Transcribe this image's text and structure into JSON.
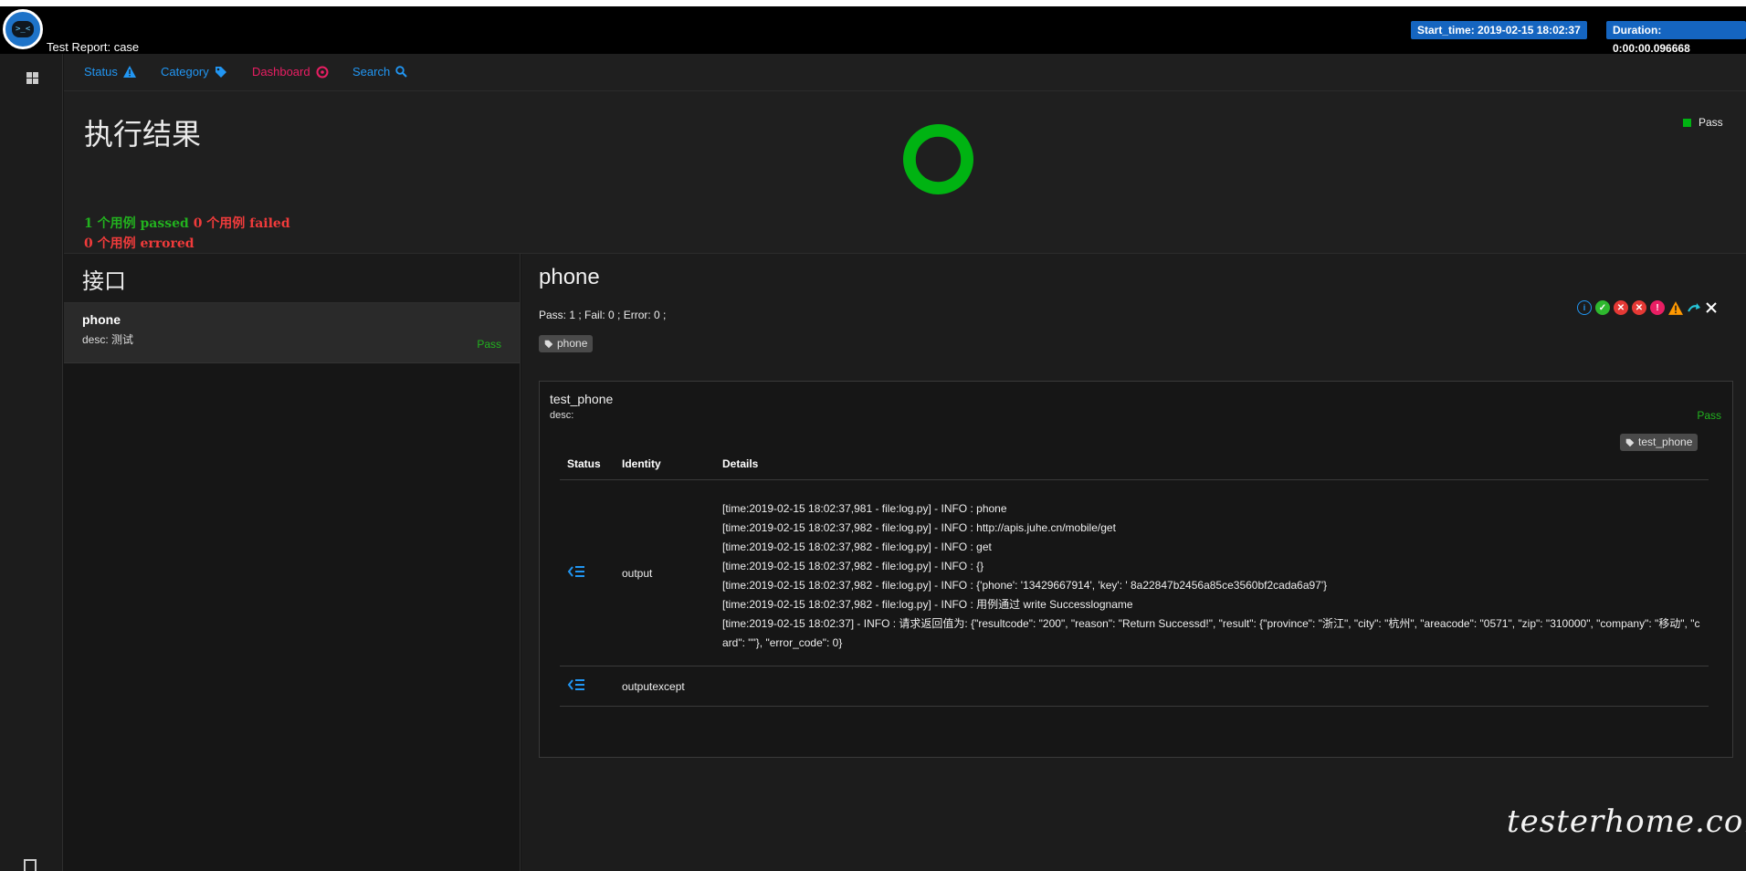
{
  "header": {
    "title": "Test Report: case",
    "start_time": "Start_time: 2019-02-15 18:02:37",
    "duration": "Duration: 0:00:00.096668"
  },
  "nav": {
    "status": "Status",
    "category": "Category",
    "dashboard": "Dashboard",
    "search": "Search"
  },
  "dashboard": {
    "title": "执行结果",
    "legend_label": "Pass",
    "pass_color": "#00b312",
    "passed": "1 个用例 passed",
    "failed": "0 个用例 failed",
    "errored": "0 个用例 errored"
  },
  "chart_data": {
    "type": "pie",
    "categories": [
      "Pass"
    ],
    "values": [
      1
    ],
    "legend": "top-right"
  },
  "left": {
    "heading": "接口",
    "case": {
      "name": "phone",
      "desc": "desc: 测试",
      "status": "Pass"
    }
  },
  "detail": {
    "title": "phone",
    "stats": "Pass: 1 ; Fail: 0 ; Error: 0 ;",
    "tag": "phone",
    "node": {
      "name": "test_phone",
      "desc": "desc:",
      "status": "Pass",
      "tag": "test_phone",
      "columns": [
        "Status",
        "Identity",
        "Details"
      ],
      "rows": [
        {
          "identity": "output",
          "lines": [
            "[time:2019-02-15 18:02:37,981 - file:log.py] - INFO : phone",
            "[time:2019-02-15 18:02:37,982 - file:log.py] - INFO : http://apis.juhe.cn/mobile/get",
            "[time:2019-02-15 18:02:37,982 - file:log.py] - INFO : get",
            "[time:2019-02-15 18:02:37,982 - file:log.py] - INFO : {}",
            "[time:2019-02-15 18:02:37,982 - file:log.py] - INFO : {'phone': '13429667914', 'key': ' 8a22847b2456a85ce3560bf2cada6a97'}",
            "[time:2019-02-15 18:02:37,982 - file:log.py] - INFO : 用例通过 write Successlogname",
            "[time:2019-02-15 18:02:37] - INFO : 请求返回值为: {\"resultcode\": \"200\", \"reason\": \"Return Successd!\", \"result\": {\"province\": \"浙江\", \"city\": \"杭州\", \"areacode\": \"0571\", \"zip\": \"310000\", \"company\": \"移动\", \"card\": \"\"}, \"error_code\": 0}"
          ]
        },
        {
          "identity": "outputexcept",
          "lines": []
        }
      ]
    }
  },
  "watermark": "testerhome.com"
}
